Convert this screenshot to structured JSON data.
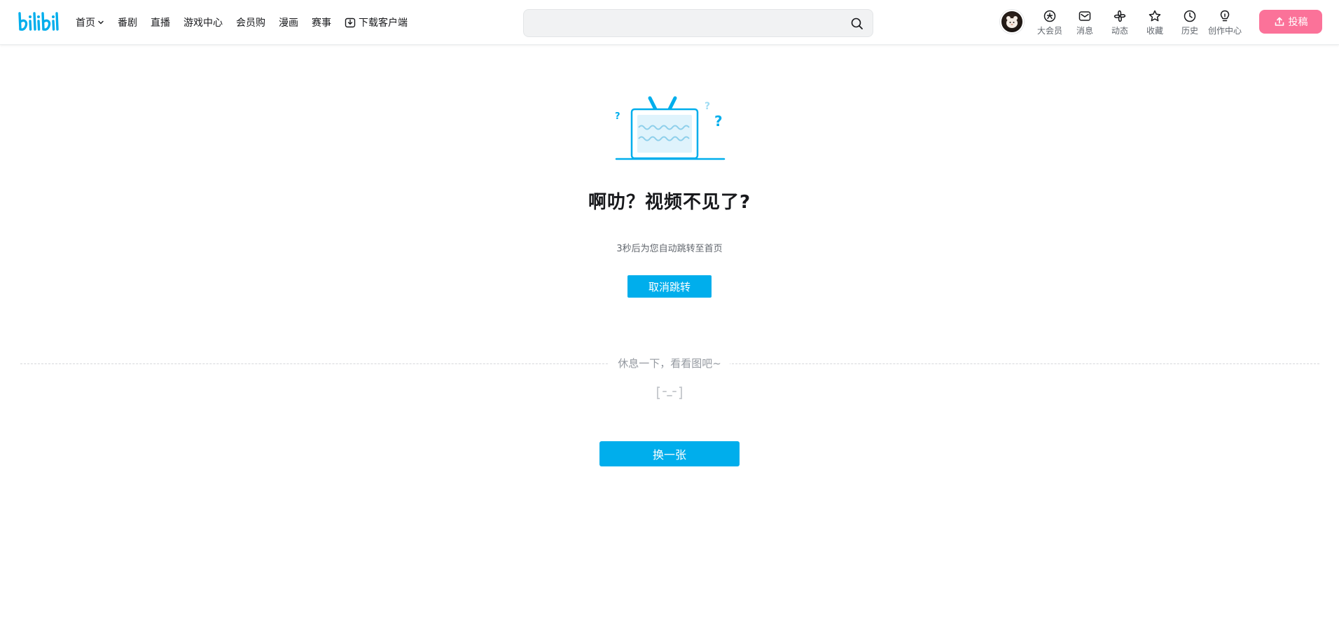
{
  "brand": {
    "logo_text": "bilibili",
    "accent_color": "#00aeec",
    "upload_color": "#fb7299"
  },
  "header": {
    "nav": [
      {
        "label": "首页",
        "icon": "chevron-down-icon"
      },
      {
        "label": "番剧"
      },
      {
        "label": "直播"
      },
      {
        "label": "游戏中心"
      },
      {
        "label": "会员购"
      },
      {
        "label": "漫画"
      },
      {
        "label": "赛事"
      },
      {
        "label": "下载客户端",
        "icon": "download-icon"
      }
    ],
    "search": {
      "placeholder": "",
      "icon": "search-icon"
    },
    "right_entries": [
      {
        "label": "大会员",
        "icon": "vip-icon"
      },
      {
        "label": "消息",
        "icon": "mail-icon"
      },
      {
        "label": "动态",
        "icon": "pinwheel-icon"
      },
      {
        "label": "收藏",
        "icon": "star-icon"
      },
      {
        "label": "历史",
        "icon": "clock-icon"
      },
      {
        "label": "创作中心",
        "icon": "lightbulb-icon"
      }
    ],
    "upload_label": "投稿"
  },
  "main": {
    "illustration": "broken-tv-icon",
    "title": "啊叻？视频不见了?",
    "redirect_text": "3秒后为您自动跳转至首页",
    "cancel_label": "取消跳转",
    "rest_label": "休息一下，看看图吧~",
    "empty_face": "[-_-]",
    "change_label": "换一张"
  }
}
